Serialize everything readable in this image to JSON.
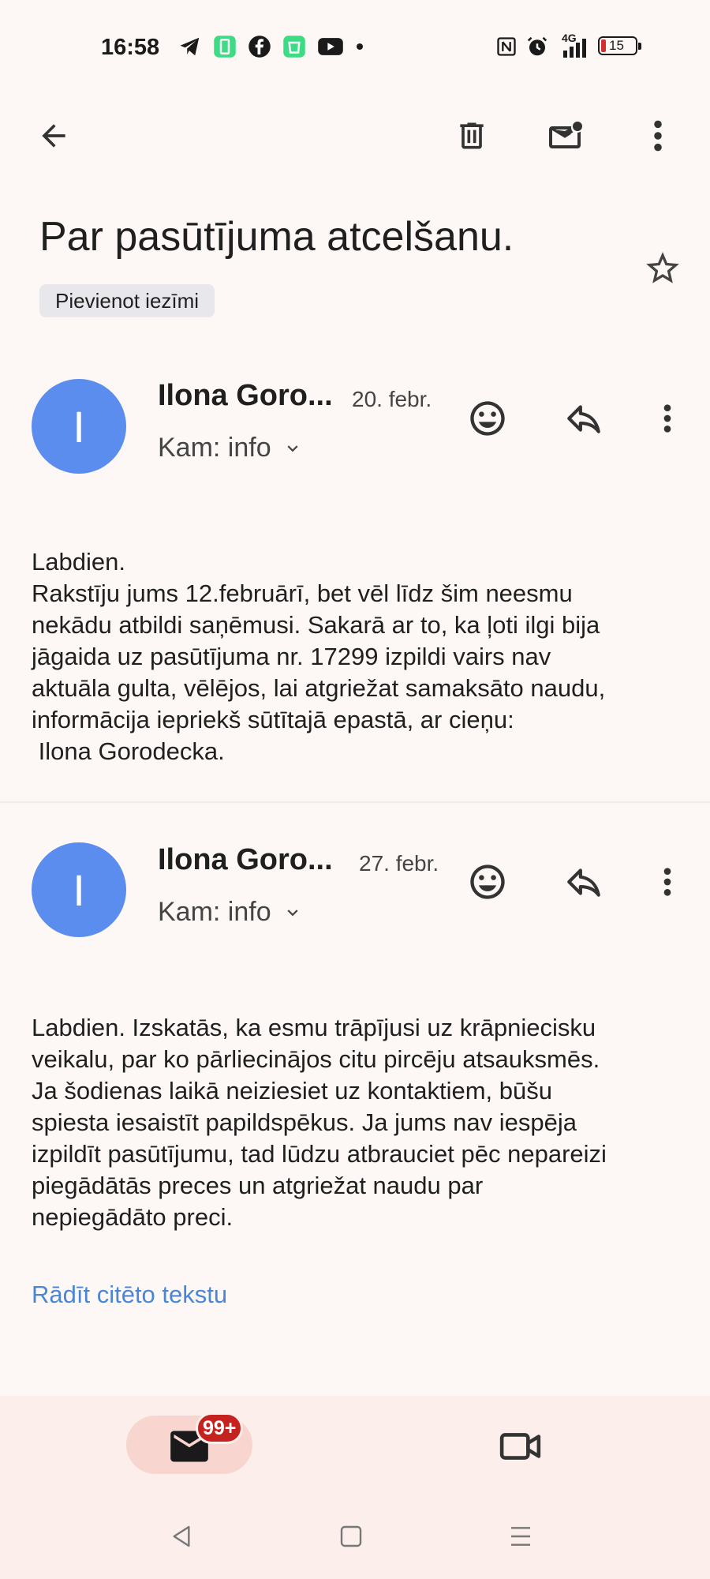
{
  "status_bar": {
    "time": "16:58",
    "battery_level": "15",
    "network": "4G"
  },
  "toolbar": {
    "back_icon": "arrow-left-icon",
    "delete_icon": "trash-icon",
    "mark_unread_icon": "mail-unread-icon",
    "more_icon": "more-vertical-icon"
  },
  "email": {
    "subject": "Par pasūtījuma atcelšanu.",
    "label_chip": "Pievienot iezīmi",
    "star_icon": "star-outline-icon"
  },
  "messages": [
    {
      "avatar_letter": "I",
      "sender": "Ilona Goro...",
      "date": "20. febr.",
      "recipient": "Kam: info",
      "body": "Labdien.\nRakstīju jums 12.februārī, bet vēl līdz šim neesmu\nnekādu atbildi saņēmusi. Sakarā ar to, ka ļoti ilgi bija\njāgaida uz pasūtījuma nr. 17299 izpildi vairs nav\naktuāla gulta, vēlējos, lai atgriežat samaksāto naudu,\ninformācija iepriekš sūtītajā epastā, ar cieņu:\n Ilona Gorodecka."
    },
    {
      "avatar_letter": "I",
      "sender": "Ilona Goro...",
      "date": "27. febr.",
      "recipient": "Kam: info",
      "body": "Labdien. Izskatās, ka esmu trāpījusi uz krāpniecisku\nveikalu, par ko pārliecinājos citu pircēju atsauksmēs.\nJa šodienas laikā neiziesiet uz kontaktiem, būšu\nspiesta iesaistīt papildspēkus. Ja jums nav iespēja\nizpildīt pasūtījumu, tad lūdzu atbrauciet pēc nepareizi\npiegādātās preces un atgriežat naudu par\nnepiegādāto preci.",
      "show_quoted": "Rādīt citēto tekstu"
    }
  ],
  "bottom_nav": {
    "mail_badge": "99+",
    "mail_icon": "mail-icon",
    "meet_icon": "video-icon"
  },
  "system_nav": {
    "back_icon": "triangle-back-icon",
    "home_icon": "square-home-icon",
    "recents_icon": "menu-lines-icon"
  },
  "colors": {
    "background": "#fdf8f5",
    "avatar": "#5b8def",
    "link": "#4a86d6",
    "badge": "#c5221f",
    "nav_background": "#fceeea"
  }
}
